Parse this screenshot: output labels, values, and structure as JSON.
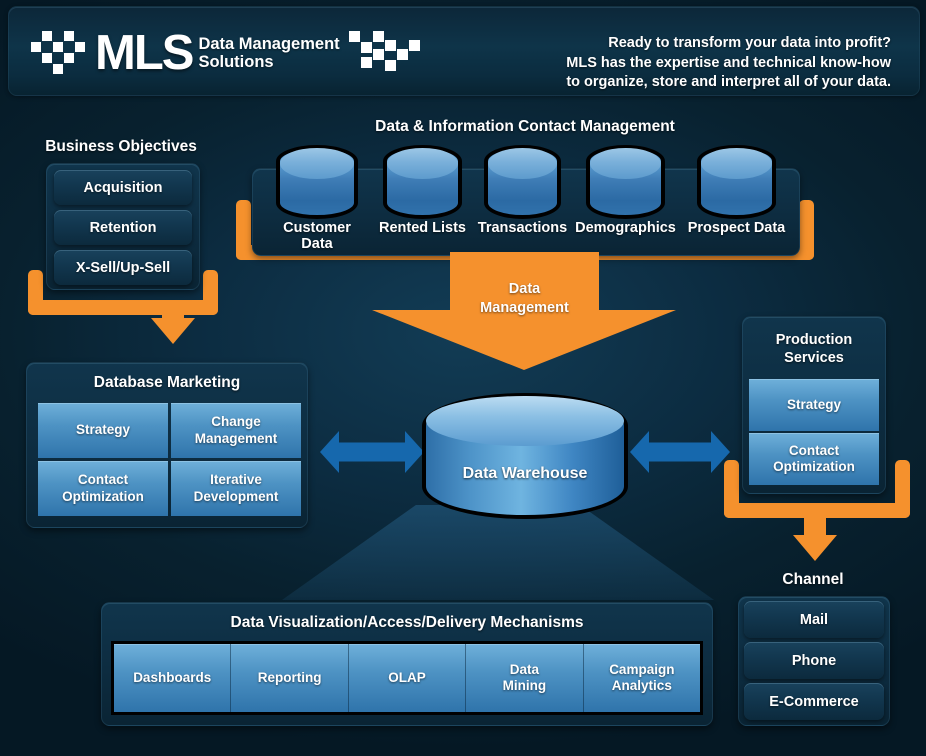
{
  "header": {
    "logo_main": "MLS",
    "logo_sub_line1": "Data Management",
    "logo_sub_line2": "Solutions",
    "tagline_line1": "Ready to transform your data into profit?",
    "tagline_line2": "MLS has the expertise and technical know-how",
    "tagline_line3": "to organize, store and interpret all of your data."
  },
  "business_objectives": {
    "title": "Business Objectives",
    "items": [
      {
        "label": "Acquisition"
      },
      {
        "label": "Retention"
      },
      {
        "label": "X-Sell/Up-Sell"
      }
    ]
  },
  "data_information": {
    "title": "Data & Information Contact Management",
    "sources": [
      {
        "label": "Customer Data"
      },
      {
        "label": "Rented Lists"
      },
      {
        "label": "Transactions"
      },
      {
        "label": "Demographics"
      },
      {
        "label": "Prospect Data"
      }
    ]
  },
  "data_management_arrow": {
    "line1": "Data",
    "line2": "Management"
  },
  "database_marketing": {
    "title": "Database Marketing",
    "tiles": [
      {
        "label": "Strategy"
      },
      {
        "label": "Change\nManagement"
      },
      {
        "label": "Contact\nOptimization"
      },
      {
        "label": "Iterative\nDevelopment"
      }
    ]
  },
  "data_warehouse": {
    "label": "Data Warehouse"
  },
  "production_services": {
    "title": "Production\nServices",
    "tiles": [
      {
        "label": "Strategy"
      },
      {
        "label": "Contact\nOptimization"
      }
    ]
  },
  "channel": {
    "title": "Channel",
    "items": [
      {
        "label": "Mail"
      },
      {
        "label": "Phone"
      },
      {
        "label": "E-Commerce"
      }
    ]
  },
  "data_visualization": {
    "title": "Data Visualization/Access/Delivery Mechanisms",
    "tiles": [
      {
        "label": "Dashboards"
      },
      {
        "label": "Reporting"
      },
      {
        "label": "OLAP"
      },
      {
        "label": "Data\nMining"
      },
      {
        "label": "Campaign\nAnalytics"
      }
    ]
  },
  "colors": {
    "accent_orange": "#f5912d",
    "arrow_blue": "#1668ad",
    "panel_blue": "#0d2c40",
    "tile_blue": "#4e93c4",
    "background": "#08212f"
  }
}
